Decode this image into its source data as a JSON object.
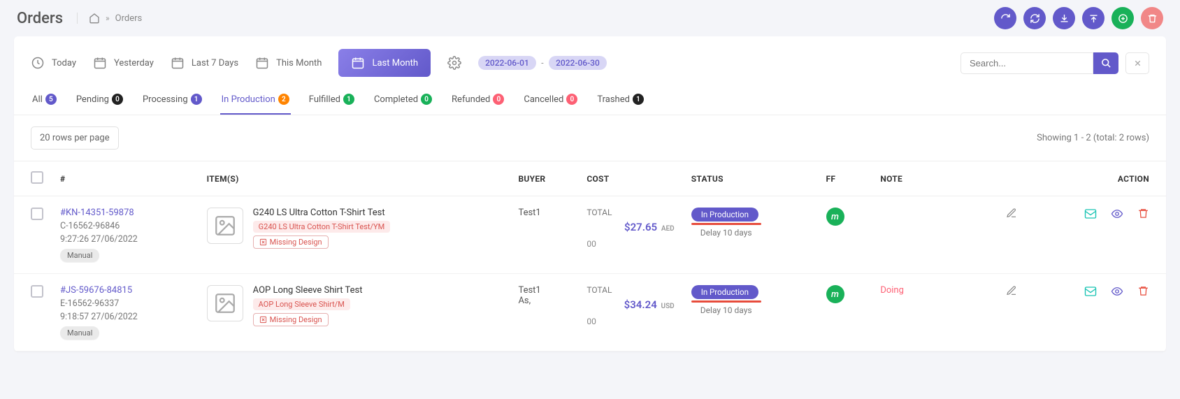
{
  "header": {
    "title": "Orders",
    "breadcrumb_current": "Orders"
  },
  "toolbar": {
    "today": "Today",
    "yesterday": "Yesterday",
    "last7": "Last 7 Days",
    "this_month": "This Month",
    "last_month": "Last Month",
    "date_from": "2022-06-01",
    "date_to": "2022-06-30",
    "date_sep": "-",
    "search_placeholder": "Search..."
  },
  "tabs": [
    {
      "label": "All",
      "count": "5",
      "class": "b-purple"
    },
    {
      "label": "Pending",
      "count": "0",
      "class": "b-dark"
    },
    {
      "label": "Processing",
      "count": "1",
      "class": "b-purple"
    },
    {
      "label": "In Production",
      "count": "2",
      "class": "b-orange",
      "active": true
    },
    {
      "label": "Fulfilled",
      "count": "1",
      "class": "b-green"
    },
    {
      "label": "Completed",
      "count": "0",
      "class": "b-green"
    },
    {
      "label": "Refunded",
      "count": "0",
      "class": "b-ored"
    },
    {
      "label": "Cancelled",
      "count": "0",
      "class": "b-ored"
    },
    {
      "label": "Trashed",
      "count": "1",
      "class": "b-dark"
    }
  ],
  "meta": {
    "rows_per_page": "20 rows per page",
    "showing": "Showing 1 - 2 (total: 2 rows)"
  },
  "columns": {
    "id": "#",
    "items": "ITEM(S)",
    "buyer": "BUYER",
    "cost": "COST",
    "status": "STATUS",
    "ff": "FF",
    "note": "NOTE",
    "action": "ACTION"
  },
  "rows": [
    {
      "order_no": "#KN-14351-59878",
      "ref": "C-16562-96846",
      "time": "9:27:26 27/06/2022",
      "source": "Manual",
      "item_name": "G240 LS Ultra Cotton T-Shirt Test",
      "variant": "G240 LS Ultra Cotton T-Shirt Test/YM",
      "missing": "Missing Design",
      "buyer": "Test1",
      "buyer2": "",
      "cost_label": "TOTAL",
      "cost_amount": "$27.65",
      "cost_curr": "AED",
      "cost_sub": "00",
      "status": "In Production",
      "delay": "Delay 10 days",
      "ff": "m",
      "note": ""
    },
    {
      "order_no": "#JS-59676-84815",
      "ref": "E-16562-96337",
      "time": "9:18:57 27/06/2022",
      "source": "Manual",
      "item_name": "AOP Long Sleeve Shirt Test",
      "variant": "AOP Long Sleeve Shirt/M",
      "missing": "Missing Design",
      "buyer": "Test1",
      "buyer2": "As,",
      "cost_label": "TOTAL",
      "cost_amount": "$34.24",
      "cost_curr": "USD",
      "cost_sub": "00",
      "status": "In Production",
      "delay": "Delay 10 days",
      "ff": "m",
      "note": "Doing"
    }
  ]
}
